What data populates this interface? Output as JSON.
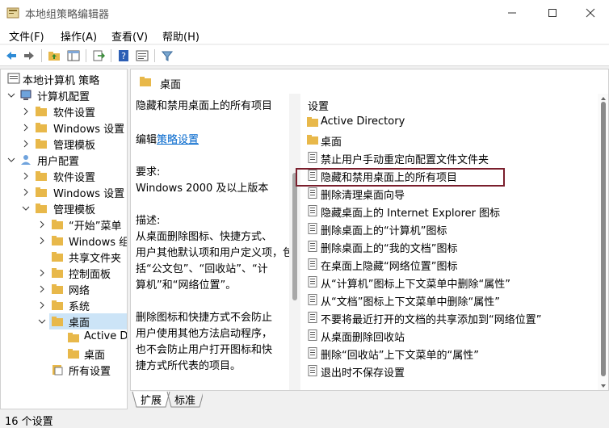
{
  "window": {
    "title": "本地组策略编辑器"
  },
  "menu": {
    "items": [
      "文件(F)",
      "操作(A)",
      "查看(V)",
      "帮助(H)"
    ]
  },
  "toolbar": {
    "buttons": [
      "back-icon",
      "forward-icon",
      "up-folder-icon",
      "show-tree-icon",
      "export-icon",
      "help-icon",
      "properties-icon",
      "filter-icon"
    ]
  },
  "tree": {
    "root": "本地计算机 策略",
    "items": [
      "计算机配置",
      "软件设置",
      "Windows 设置",
      "管理模板",
      "用户配置",
      "软件设置",
      "Windows 设置",
      "管理模板",
      "“开始”菜单",
      "Windows 组",
      "共享文件夹",
      "控制面板",
      "网络",
      "系统",
      "桌面",
      "Active D",
      "桌面",
      "所有设置"
    ]
  },
  "right": {
    "header": "桌面",
    "description": {
      "title": "隐藏和禁用桌面上的所有项目",
      "edit_prefix": "编辑",
      "edit_link": "策略设置",
      "req_label": "要求:",
      "req_value": "Windows 2000 及以上版本",
      "desc_label": "描述:",
      "desc_lines": [
        "从桌面删除图标、快捷方式、",
        "用户其他默认项和用户定义项，包",
        "括“公文包”、“回收站”、“计",
        "算机”和“网络位置”。",
        "",
        "删除图标和快捷方式不会防止",
        "用户使用其他方法启动程序，",
        "也不会防止用户打开图标和快",
        "捷方式所代表的项目。"
      ]
    },
    "list_header": "设置",
    "list": [
      {
        "label": "Active Directory",
        "type": "folder"
      },
      {
        "label": "桌面",
        "type": "folder"
      },
      {
        "label": "禁止用户手动重定向配置文件文件夹",
        "type": "setting"
      },
      {
        "label": "隐藏和禁用桌面上的所有项目",
        "type": "setting"
      },
      {
        "label": "删除清理桌面向导",
        "type": "setting"
      },
      {
        "label": "隐藏桌面上的 Internet Explorer 图标",
        "type": "setting"
      },
      {
        "label": "删除桌面上的“计算机”图标",
        "type": "setting"
      },
      {
        "label": "删除桌面上的“我的文档”图标",
        "type": "setting"
      },
      {
        "label": "在桌面上隐藏“网络位置”图标",
        "type": "setting"
      },
      {
        "label": "从“计算机”图标上下文菜单中删除“属性”",
        "type": "setting"
      },
      {
        "label": "从“文档”图标上下文菜单中删除“属性”",
        "type": "setting"
      },
      {
        "label": "不要将最近打开的文档的共享添加到“网络位置”",
        "type": "setting"
      },
      {
        "label": "从桌面删除回收站",
        "type": "setting"
      },
      {
        "label": "删除“回收站”上下文菜单的“属性”",
        "type": "setting"
      },
      {
        "label": "退出时不保存设置",
        "type": "setting"
      }
    ]
  },
  "tabs": [
    "扩展",
    "标准"
  ],
  "status": "16 个设置",
  "colors": {
    "highlight_border": "#7a1e2c",
    "link": "#0066cc",
    "folder": "#e8b84a"
  }
}
